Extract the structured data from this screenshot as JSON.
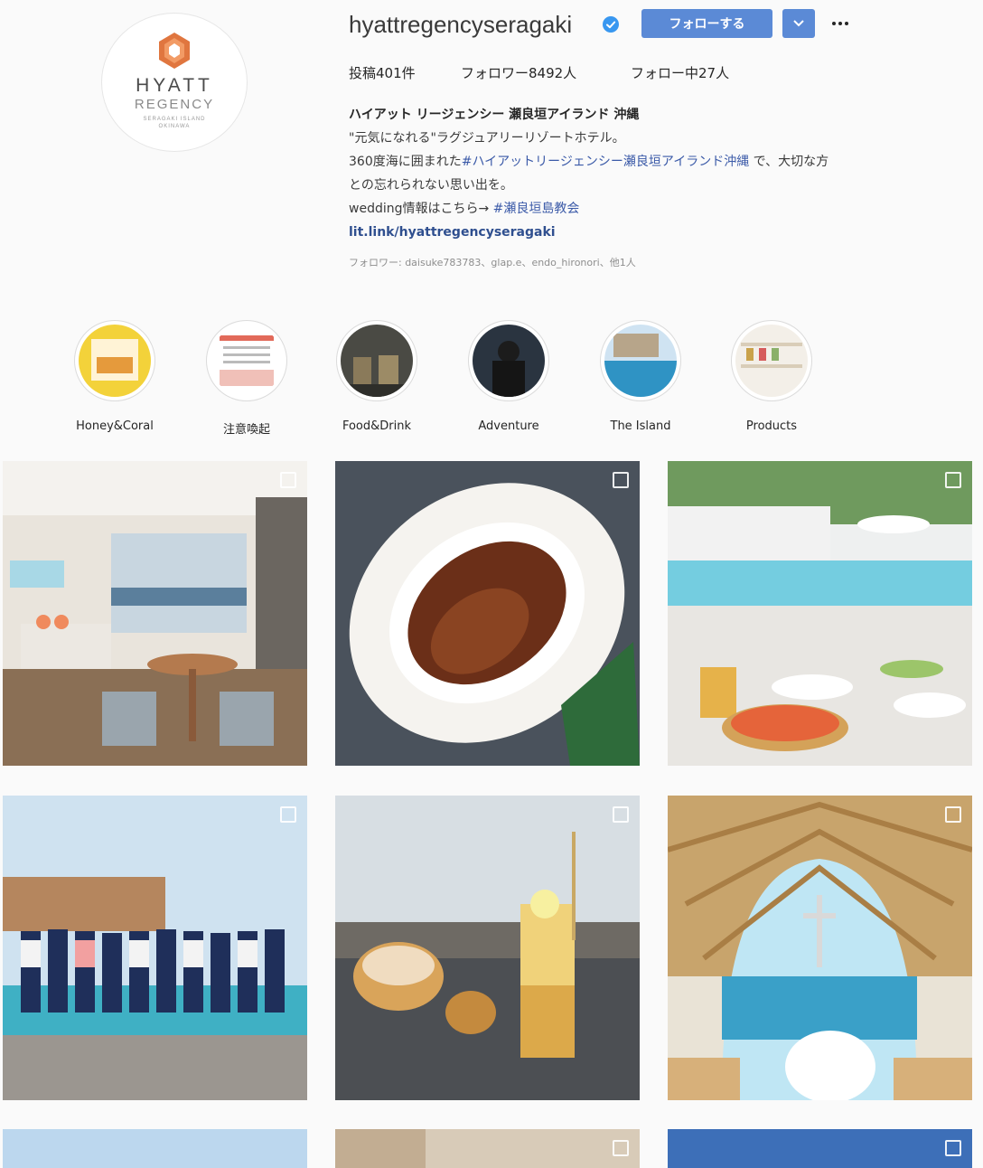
{
  "profile": {
    "avatar": {
      "brand_line1": "HYATT",
      "brand_line2": "REGENCY",
      "brand_line3": "SERAGAKI ISLAND",
      "brand_line4": "OKINAWA"
    },
    "username": "hyattregencyseragaki",
    "verified_icon": "verified-badge-icon",
    "follow_label": "フォローする",
    "dropdown_icon": "chevron-down-icon",
    "more_icon": "more-options-icon",
    "stats": {
      "posts": "投稿401件",
      "followers": "フォロワー8492人",
      "following": "フォロー中27人"
    },
    "bio": {
      "name": "ハイアット リージェンシー 瀬良垣アイランド 沖縄",
      "line1": "\"元気になれる\"ラグジュアリーリゾートホテル。",
      "line2_prefix": "360度海に囲まれた",
      "line2_tag": "#ハイアットリージェンシー瀬良垣アイランド沖縄",
      "line2_suffix": " で、大切な方",
      "line3": "との忘れられない思い出を。",
      "line4_prefix": "wedding情報はこちら→ ",
      "line4_tag": "#瀬良垣島教会",
      "link": "lit.link/hyattregencyseragaki"
    },
    "followed_by": "フォロワー: daisuke783783、glap.e、endo_hironori、他1人"
  },
  "highlights": [
    {
      "label": "Honey&Coral"
    },
    {
      "label": "注意喚起"
    },
    {
      "label": "Food&Drink"
    },
    {
      "label": "Adventure"
    },
    {
      "label": "The Island"
    },
    {
      "label": "Products"
    }
  ],
  "posts": [
    {
      "name": "post-hotel-room",
      "multi": true
    },
    {
      "name": "post-steak-plate",
      "multi": true
    },
    {
      "name": "post-poolside-dining",
      "multi": true
    },
    {
      "name": "post-staff-group-photo",
      "multi": true
    },
    {
      "name": "post-pastry-drink",
      "multi": true
    },
    {
      "name": "post-chapel-wedding",
      "multi": true
    },
    {
      "name": "post-partial-sky",
      "multi": false
    },
    {
      "name": "post-partial-interior",
      "multi": true
    },
    {
      "name": "post-partial-blue",
      "multi": true
    }
  ],
  "colors": {
    "accent": "#5b8ad6",
    "link": "#3b5aa8",
    "brand_orange": "#e0763f",
    "background": "#fafafa"
  }
}
